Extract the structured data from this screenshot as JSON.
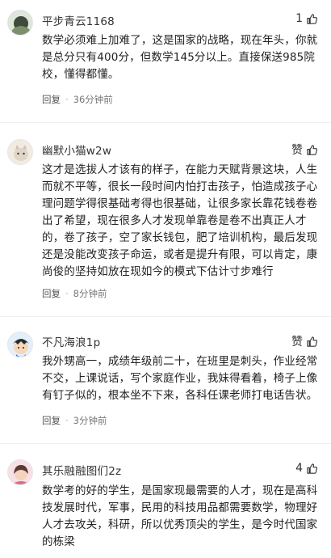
{
  "comments": [
    {
      "user": "平步青云1168",
      "likes": "1",
      "text": "数学必须难上加难了，这是国家的战略，现在年头，你就是总分只有400分，但数学145分以上。直接保送985院校，懂得都懂。",
      "reply_label": "回复",
      "dot": "·",
      "time": "36分钟前"
    },
    {
      "user": "幽默小猫w2w",
      "likes": "赞",
      "text": "这才是选拔人才该有的样子，在能力天赋背景这块，人生而就不平等，很长一段时间内怕打击孩子，怕造成孩子心理问题学得很基础考得也很基础，让很多家长靠花钱卷卷出了希望，现在很多人才发现单靠卷是卷不出真正人才的，卷了孩子，空了家长钱包，肥了培训机构，最后发现还是没能改变孩子命运，或者是提升有限，可以肯定，康尚俊的坚持如放在现如今的模式下估计寸步难行",
      "reply_label": "回复",
      "dot": "·",
      "time": "8分钟前"
    },
    {
      "user": "不凡海浪1p",
      "likes": "赞",
      "text": "我外甥高一，成绩年级前二十，在班里是刺头，作业经常不交，上课说话，写个家庭作业，我妹得看着，椅子上像有钉子似的，根本坐不下来，各科任课老师打电话告状。",
      "reply_label": "回复",
      "dot": "·",
      "time": "3分钟前"
    },
    {
      "user": "其乐融融图们2z",
      "likes": "4",
      "text": "数学考的好的学生，是国家现最需要的人才，现在是高科技发展时代，军事，民用的科技用品都需要数学，物理好人才去攻关，科研，所以优秀顶尖的学生，是今时代国家的栋梁"
    }
  ],
  "colors": {
    "text": "#222222",
    "meta": "#777777",
    "divider": "#efefef"
  }
}
